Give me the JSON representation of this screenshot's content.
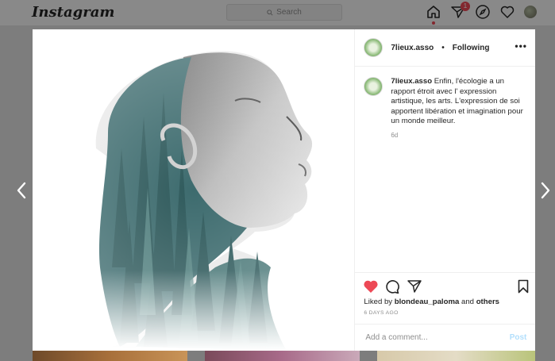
{
  "topbar": {
    "logo": "Instagram",
    "search_placeholder": "Search",
    "activity_badge": "1",
    "icons": [
      "home-icon",
      "direct-icon",
      "explore-icon",
      "heart-icon",
      "profile-avatar"
    ]
  },
  "post": {
    "username": "7lieux.asso",
    "separator": "•",
    "follow_state": "Following",
    "more": "•••",
    "caption_user": "7lieux.asso",
    "caption_text": "Enfin, l'écologie a un rapport étroit avec l' expression artistique, les arts. L'expression de soi apportent libération et imagination pour un monde meilleur.",
    "caption_time": "6d",
    "liked_prefix": "Liked by",
    "liked_user": "blondeau_paloma",
    "liked_and": "and",
    "liked_others": "others",
    "time_ago": "6 DAYS AGO",
    "comment_placeholder": "Add a comment...",
    "post_button": "Post"
  },
  "colors": {
    "like_red": "#ed4956",
    "link_blue": "#0095f6"
  }
}
